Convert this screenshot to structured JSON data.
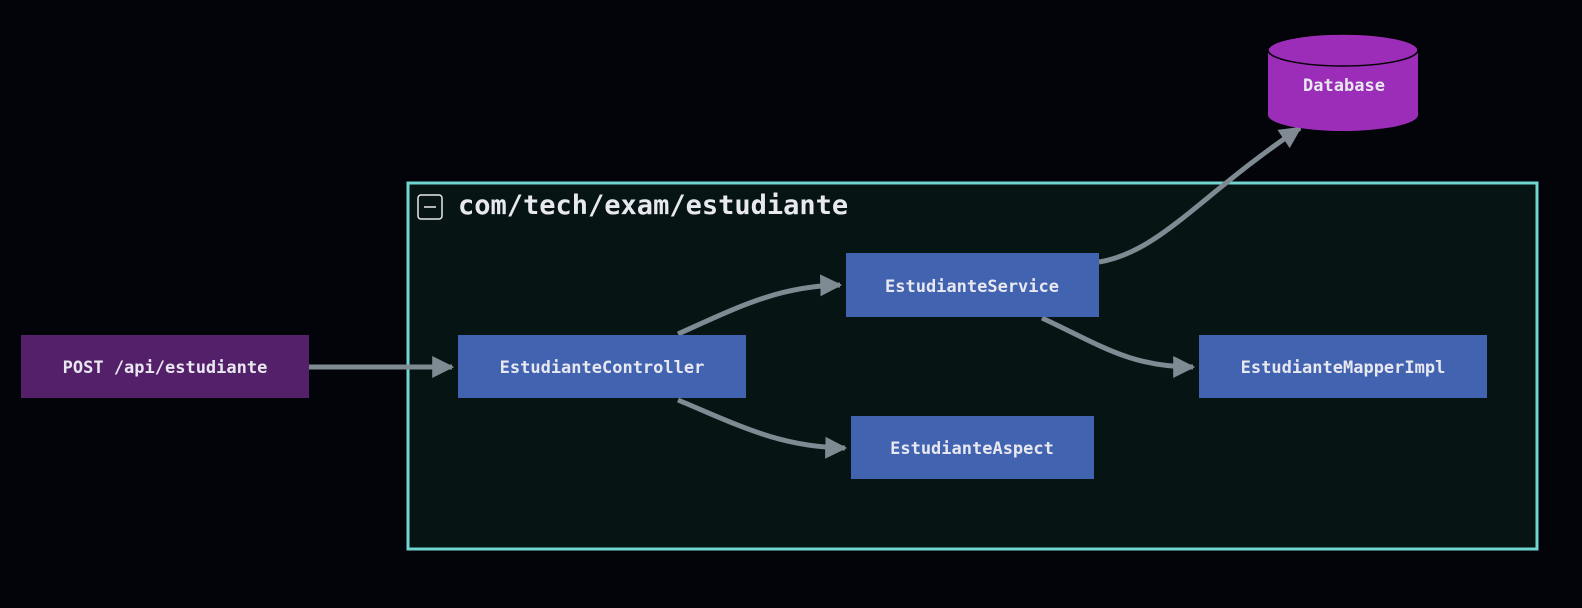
{
  "cluster": {
    "title": "com/tech/exam/estudiante",
    "border_color": "#6fd6d0",
    "fill_color": "#061413",
    "collapse_icon": "minus-square-icon"
  },
  "nodes": {
    "endpoint": {
      "label": "POST /api/estudiante",
      "color": "#55206a"
    },
    "controller": {
      "label": "EstudianteController",
      "color": "#4263b0"
    },
    "service": {
      "label": "EstudianteService",
      "color": "#4263b0"
    },
    "aspect": {
      "label": "EstudianteAspect",
      "color": "#4263b0"
    },
    "mapper": {
      "label": "EstudianteMapperImpl",
      "color": "#4263b0"
    },
    "database": {
      "label": "Database",
      "color": "#9b2db8"
    }
  },
  "edges": [
    {
      "from": "POST /api/estudiante",
      "to": "EstudianteController"
    },
    {
      "from": "EstudianteController",
      "to": "EstudianteService"
    },
    {
      "from": "EstudianteController",
      "to": "EstudianteAspect"
    },
    {
      "from": "EstudianteService",
      "to": "EstudianteMapperImpl"
    },
    {
      "from": "EstudianteService",
      "to": "Database"
    }
  ]
}
